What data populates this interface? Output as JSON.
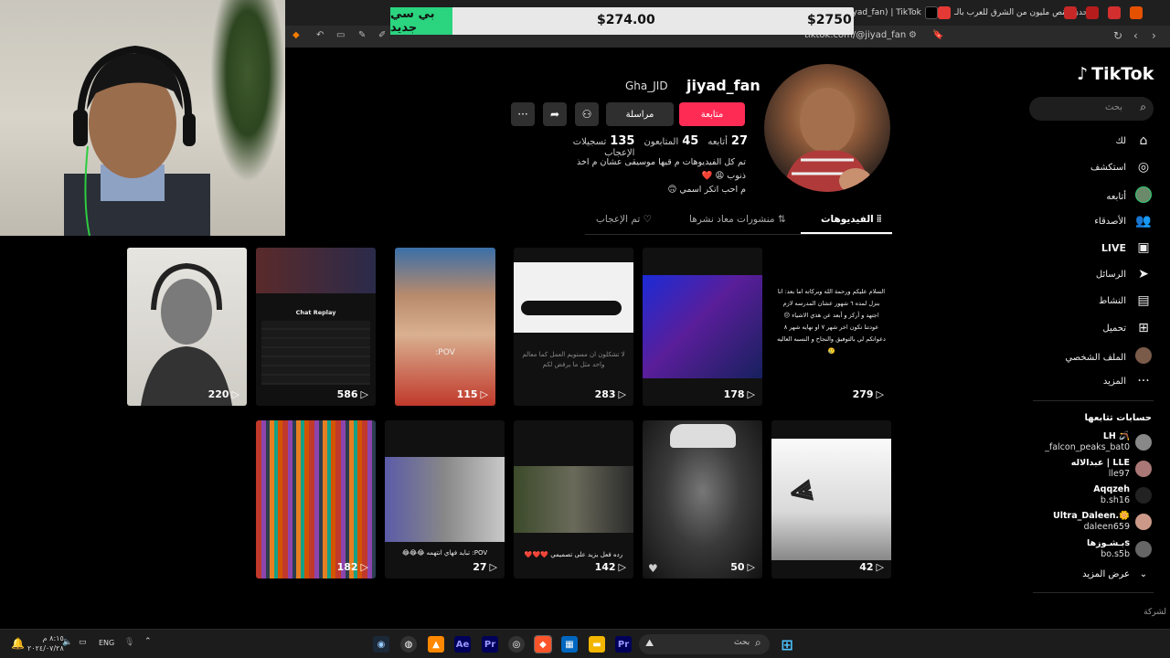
{
  "browser": {
    "tabs": [
      {
        "label": "يحدي النص مليون من الشرق للعرب بالـ"
      },
      {
        "label": "iyad_fan) | TikTok"
      }
    ],
    "url": "tiktok.com/@jiyad_fan"
  },
  "price_overlay": {
    "badge": "بي سي جديد",
    "price_mid": "$274.00",
    "price_right": "$2750"
  },
  "sidebar": {
    "logo": "TikTok",
    "search_placeholder": "بحث",
    "nav": [
      {
        "label": "لك",
        "icon": "home-icon"
      },
      {
        "label": "استكشف",
        "icon": "compass-icon"
      },
      {
        "label": "أتابعه",
        "icon": "following-avatar-icon"
      },
      {
        "label": "الأصدقاء",
        "icon": "friends-icon"
      },
      {
        "label": "LIVE",
        "icon": "live-icon"
      },
      {
        "label": "الرسائل",
        "icon": "send-icon"
      },
      {
        "label": "النشاط",
        "icon": "activity-icon"
      },
      {
        "label": "تحميل",
        "icon": "upload-icon"
      },
      {
        "label": "الملف الشخصي",
        "icon": "profile-icon"
      },
      {
        "label": "المزيد",
        "icon": "more-icon"
      }
    ],
    "following_title": "حسابات تتابعها",
    "following": [
      {
        "name": "LH 🪃",
        "user": "_falcon_peaks_bat0"
      },
      {
        "name": "عبدالاله | LLE",
        "user": "lle97"
      },
      {
        "name": "Aqqzeh",
        "user": "b.sh16"
      },
      {
        "name": "Ultra_Daleen.🌼",
        "user": "daleen659"
      },
      {
        "name": "بـشـوزهاs",
        "user": "bo.s5b"
      }
    ],
    "show_more": "عرض المزيد",
    "footer": "لشركة"
  },
  "profile": {
    "username": "jiyad_fan",
    "nickname": "Gha_JID",
    "follow_label": "متابعة",
    "message_label": "مراسلة",
    "stats": {
      "following_count": "27",
      "following_label": "أتابعه",
      "followers_count": "45",
      "followers_label": "المتابعون",
      "likes_count": "135",
      "likes_label": "تسجيلات الإعجاب"
    },
    "bio_line1": "تم كل الفيديوهات م قيها موسيقى عشان م اخذ ذنوب 😩 ❤️",
    "bio_line2": "م احب اتكر اسمي 🙃",
    "tabs": [
      {
        "label": "الفيديوهات",
        "icon": "grid-icon"
      },
      {
        "label": "منشورات معاد نشرها",
        "icon": "repost-icon"
      },
      {
        "label": "تم الإعجاب",
        "icon": "heart-off-icon"
      }
    ]
  },
  "videos": [
    {
      "views": "279",
      "caption": "السلام عليكم ورحمة الله وبركاته اما بعد: انا بنزل لمده ٦ شهور عشان المدرسه لازم اجتهد و أركز و أبعد عن هذي الاشياء 😔 عودتنا تكون اخر شهر ٧ او نهايه شهر ٨ دعواتكم لي بالتوفيق والنجاح و النسبه العاليه 🥲"
    },
    {
      "views": "178",
      "caption": ""
    },
    {
      "views": "283",
      "caption": "لا تشكلون ان مستويم العمل كما معالم واحد مثل ما يرفض لكم"
    },
    {
      "views": "115",
      "caption": "POV:"
    },
    {
      "views": "586",
      "caption": "Chat Replay"
    },
    {
      "views": "220",
      "caption": ""
    },
    {
      "views": "42",
      "caption": ""
    },
    {
      "views": "50",
      "caption": ""
    },
    {
      "views": "142",
      "caption": "رده فعل يزيد على تصميمي ❤️❤️❤️"
    },
    {
      "views": "27",
      "caption": "POV: تبايد فهاي انتهمه 😂😂😂"
    },
    {
      "views": "182",
      "caption": ""
    }
  ],
  "taskbar": {
    "search_placeholder": "بحث",
    "lang": "ENG",
    "time": "٨:١٥ م",
    "date": "٢٠٢٤/٠٧/٢٨",
    "apps": [
      "Ae",
      "Pr",
      "Pr"
    ]
  },
  "colors": {
    "accent": "#fe2c55",
    "overlay_badge": "#2bd47f"
  }
}
